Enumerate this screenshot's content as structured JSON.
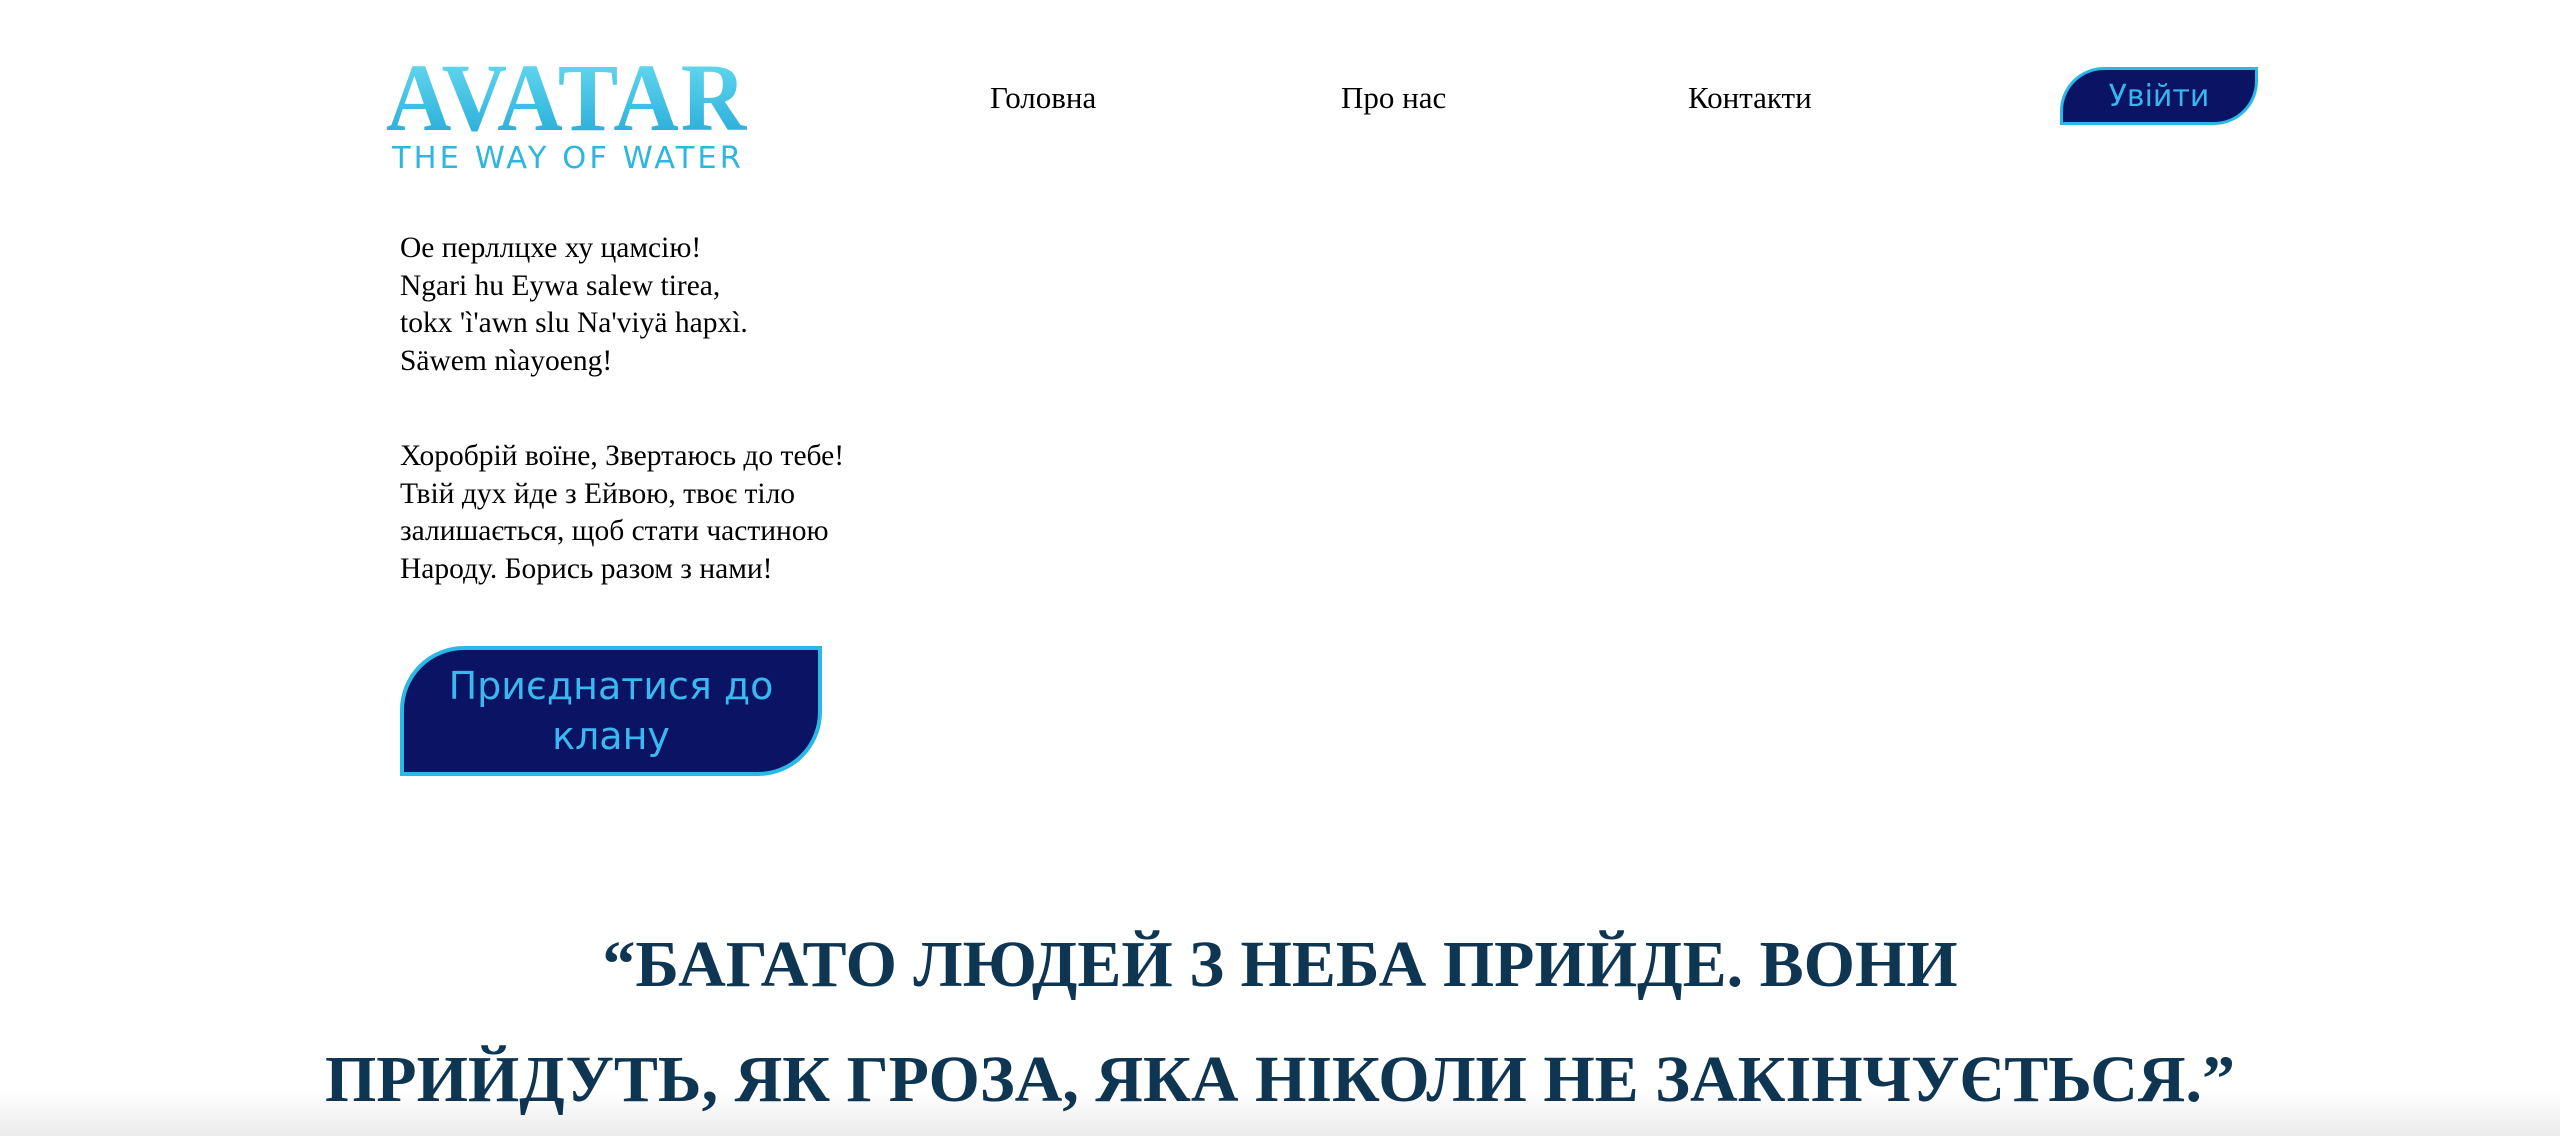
{
  "header": {
    "logo": {
      "title": "AVATAR",
      "subtitle": "THE WAY OF WATER",
      "color": "#35c3e8"
    },
    "nav": {
      "home": "Головна",
      "about": "Про нас",
      "contacts": "Контакти"
    },
    "login_label": "Увійти"
  },
  "poem": {
    "navi": [
      "Oe перллцхе ху цамсію!",
      "Ngari hu Eywa salew tirea,",
      "tokx 'ì'awn slu Na'viyä hapxì.",
      "Säwem nìayoeng!"
    ],
    "ukrainian": [
      "Хоробрій воїне, Звертаюсь до тебе!",
      "Твій дух йде з Ейвою, твоє тіло",
      "залишається, щоб стати частиною",
      "Народу. Борись разом з нами!"
    ]
  },
  "join_label": "Приєднатися до клану",
  "quote": {
    "line1": "“БАГАТО ЛЮДЕЙ З НЕБА ПРИЙДЕ. ВОНИ",
    "line2": "ПРИЙДУТЬ, ЯК ГРОЗА, ЯКА НІКОЛИ НЕ ЗАКІНЧУЄТЬСЯ.”"
  },
  "colors": {
    "button_bg": "#0b1464",
    "button_border": "#2ab8e6",
    "button_text": "#38b6ec",
    "quote_text": "#0e3552"
  }
}
